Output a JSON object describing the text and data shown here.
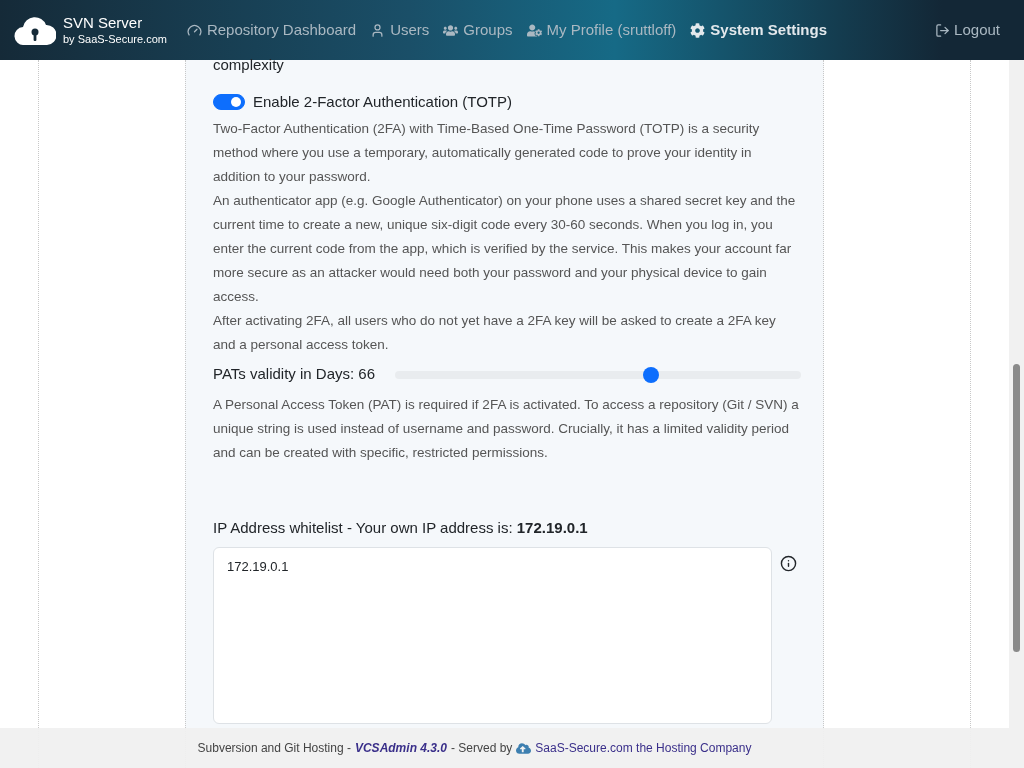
{
  "brand": {
    "title": "SVN Server",
    "subtitle": "by SaaS-Secure.com"
  },
  "nav": [
    {
      "label": "Repository Dashboard",
      "selected": false
    },
    {
      "label": "Users",
      "selected": false
    },
    {
      "label": "Groups",
      "selected": false
    },
    {
      "label": "My Profile (sruttloff)",
      "selected": false
    },
    {
      "label": "System Settings",
      "selected": true
    }
  ],
  "logout": {
    "label": "Logout"
  },
  "settings": {
    "cut_text": "complexity",
    "two_factor": {
      "label": "Enable 2-Factor Authentication (TOTP)",
      "on": true
    },
    "description": [
      "Two-Factor Authentication (2FA) with Time-Based One-Time Password (TOTP) is a security method where you use a temporary, automatically generated code to prove your identity in addition to your password.",
      "An authenticator app (e.g. Google Authenticator) on your phone uses a shared secret key and the current time to create a new, unique six-digit code every 30-60 seconds. When you log in, you enter the current code from the app, which is verified by the service. This makes your account far more secure as an attacker would need both your password and your physical device to gain access.",
      "After activating 2FA, all users who do not yet have a 2FA key will be asked to create a 2FA key and a personal access token."
    ],
    "pat_slider": {
      "label": "PATs validity in Days: 66",
      "level": 0.63
    },
    "pat_description": "A Personal Access Token (PAT) is required if 2FA is activated. To access a repository (Git / SVN) a unique string is used instead of username and password. Crucially, it has a limited validity period and can be created with specific, restricted permissions.",
    "ip_whitelist": {
      "label": "IP Address whitelist - Your own IP address is: **172.19.0.1**",
      "value": "172.19.0.1"
    }
  },
  "footer": {
    "text_before": "Subversion and Git Hosting -",
    "product": "VCSAdmin 4.3.0",
    "text_after": "- Served by",
    "link": "SaaS-Secure.com the Hosting Company"
  }
}
